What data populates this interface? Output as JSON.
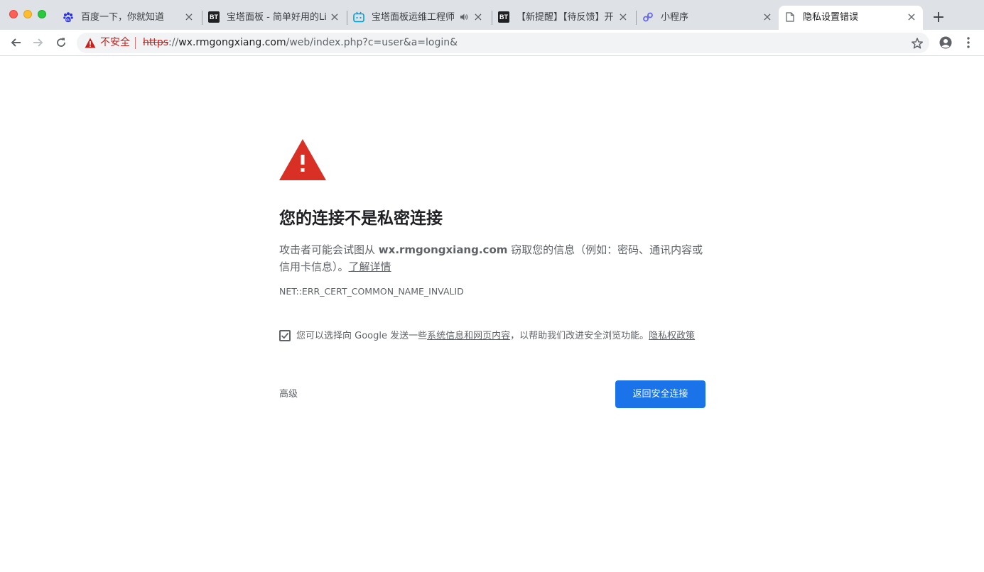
{
  "tabs": [
    {
      "title": "百度一下，你就知道",
      "icon": "baidu-paw-icon"
    },
    {
      "title": "宝塔面板 - 简单好用的Lin",
      "icon": "bt-logo-icon"
    },
    {
      "title": "宝塔面板运维工程师",
      "icon": "bilibili-tv-icon",
      "audio": true
    },
    {
      "title": "【新提醒】【待反馈】开",
      "icon": "bt-logo-icon"
    },
    {
      "title": "小程序",
      "icon": "miniprogram-icon"
    },
    {
      "title": "隐私设置错误",
      "icon": "document-icon",
      "active": true
    }
  ],
  "bt_icon_text": "BT",
  "toolbar": {
    "insecure_label": "不安全",
    "url_scheme": "https",
    "url_sep": "://",
    "url_host": "wx.rmgongxiang.com",
    "url_path": "/web/index.php?c=user&a=login&"
  },
  "interstitial": {
    "heading": "您的连接不是私密连接",
    "explain_before": "攻击者可能会试图从 ",
    "explain_host": "wx.rmgongxiang.com",
    "explain_after": " 窃取您的信息（例如：密码、通讯内容或信用卡信息）。",
    "learn_more": "了解详情",
    "error_code": "NET::ERR_CERT_COMMON_NAME_INVALID",
    "opt_in_before": "您可以选择向 Google 发送一些",
    "opt_in_link": "系统信息和网页内容",
    "opt_in_after": "，以帮助我们改进安全浏览功能。",
    "privacy_link": "隐私权政策",
    "advanced": "高级",
    "back_button": "返回安全连接"
  },
  "colors": {
    "warning_red": "#d93025",
    "primary_blue": "#1a73e8",
    "tab_strip": "#dee1e6"
  }
}
